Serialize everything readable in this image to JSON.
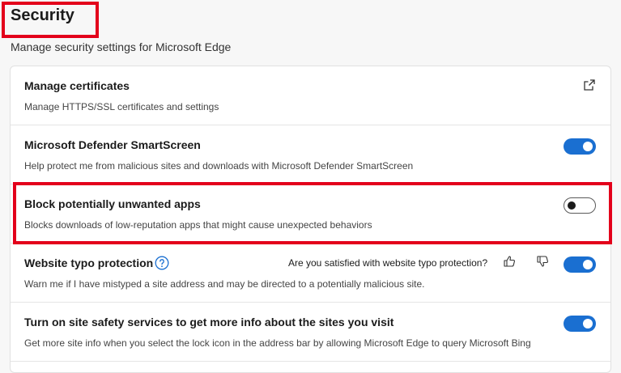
{
  "page": {
    "title": "Security",
    "subtitle": "Manage security settings for Microsoft Edge"
  },
  "settings": [
    {
      "title": "Manage certificates",
      "description": "Manage HTTPS/SSL certificates and settings",
      "control": "external-link-icon"
    },
    {
      "title": "Microsoft Defender SmartScreen",
      "description": "Help protect me from malicious sites and downloads with Microsoft Defender SmartScreen",
      "toggle_on": true
    },
    {
      "title": "Block potentially unwanted apps",
      "description": "Blocks downloads of low-reputation apps that might cause unexpected behaviors",
      "toggle_on": false
    },
    {
      "title": "Website typo protection",
      "description": "Warn me if I have mistyped a site address and may be directed to a potentially malicious site.",
      "feedback_question": "Are you satisfied with website typo protection?",
      "toggle_on": true
    },
    {
      "title": "Turn on site safety services to get more info about the sites you visit",
      "description": "Get more site info when you select the lock icon in the address bar by allowing Microsoft Edge to query Microsoft Bing",
      "toggle_on": true
    }
  ],
  "colors": {
    "accent": "#1a6fd1",
    "highlight": "#e3001b"
  }
}
